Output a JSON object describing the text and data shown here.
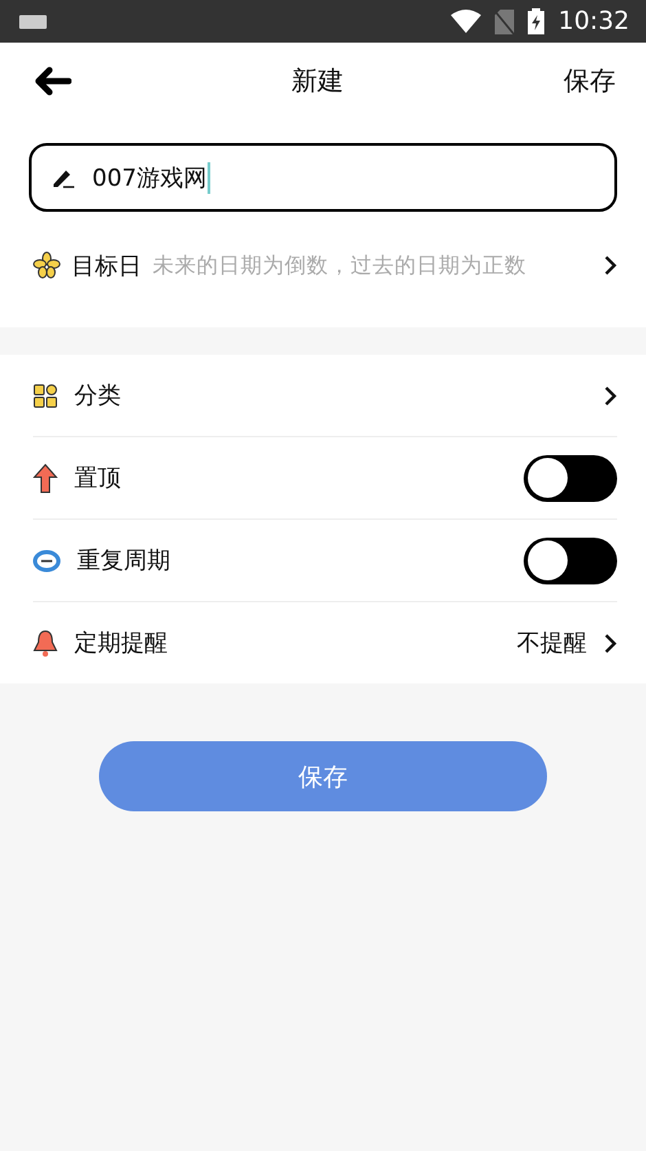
{
  "status_bar": {
    "time": "10:32"
  },
  "header": {
    "title": "新建",
    "action": "保存"
  },
  "name_field": {
    "value": "007游戏网"
  },
  "target_date": {
    "label": "目标日",
    "placeholder": "未来的日期为倒数，过去的日期为正数"
  },
  "settings": [
    {
      "kind": "link",
      "label": "分类"
    },
    {
      "kind": "toggle",
      "label": "置顶",
      "on": false
    },
    {
      "kind": "toggle",
      "label": "重复周期",
      "on": false
    },
    {
      "kind": "link",
      "label": "定期提醒",
      "value": "不提醒"
    }
  ],
  "save_button": "保存"
}
